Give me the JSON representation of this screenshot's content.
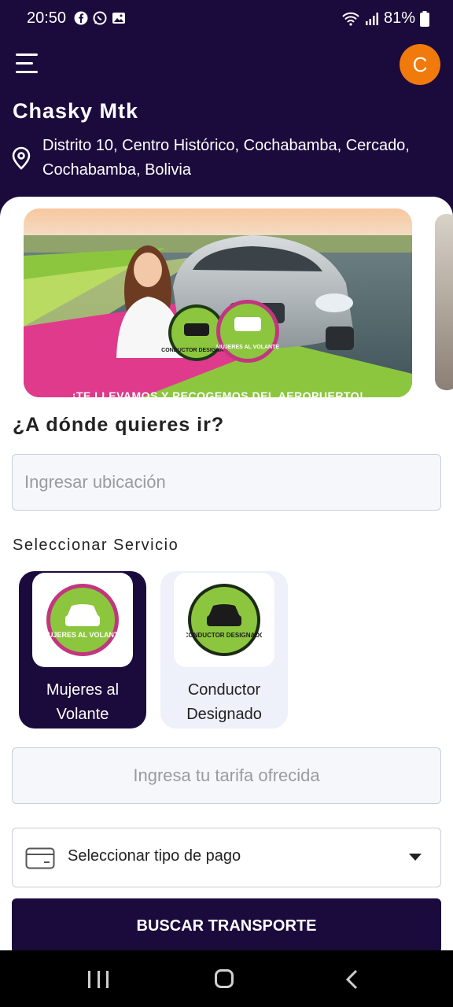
{
  "status_bar": {
    "time": "20:50",
    "battery": "81%"
  },
  "header": {
    "avatar_initial": "C",
    "company_name": "Chasky Mtk",
    "address": "Distrito 10, Centro Histórico, Cochabamba, Cercado, Cochabamba, Bolivia"
  },
  "banner": {
    "caption": "¡TE LLEVAMOS Y RECOGEMOS DEL AEROPUERTO!",
    "badge_left": "CONDUCTOR DESIGNADO",
    "badge_right": "MUJERES AL VOLANTE"
  },
  "destination": {
    "title": "¿A dónde quieres ir?",
    "placeholder": "Ingresar ubicación"
  },
  "services": {
    "title": "Seleccionar Servicio",
    "items": [
      {
        "label": "Mujeres al Volante",
        "badge": "MUJERES AL VOLANTE",
        "selected": true
      },
      {
        "label": "Conductor Designado",
        "badge": "CONDUCTOR DESIGNADO",
        "selected": false
      }
    ]
  },
  "fare": {
    "placeholder": "Ingresa tu tarifa ofrecida"
  },
  "payment": {
    "label": "Seleccionar tipo de pago"
  },
  "search_button": {
    "label": "BUSCAR TRANSPORTE"
  },
  "colors": {
    "primary": "#1b0a3c",
    "accent": "#f07a0c",
    "badge_green": "#8cc63f",
    "badge_pink": "#c2367f"
  }
}
